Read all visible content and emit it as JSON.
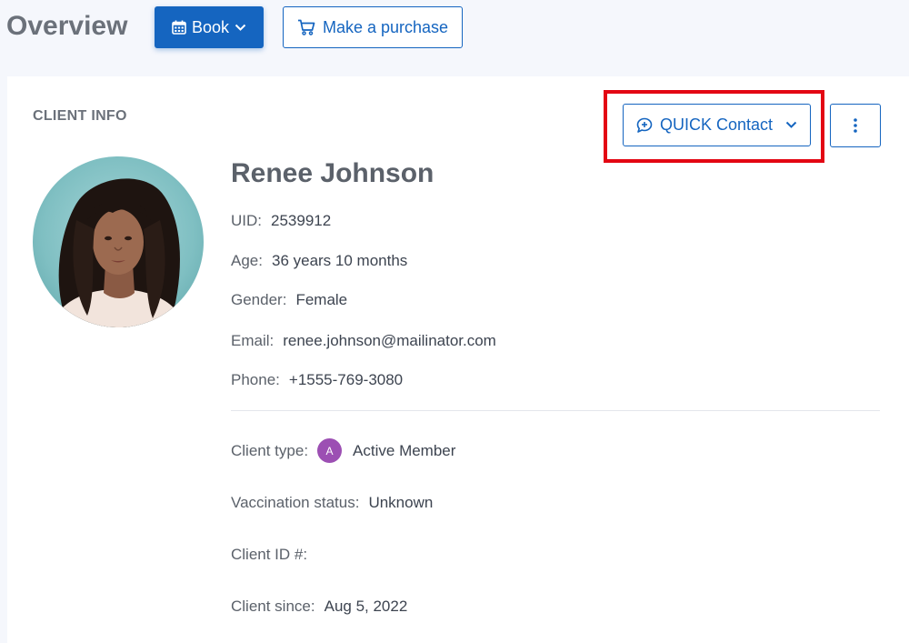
{
  "header": {
    "title": "Overview",
    "book_button": {
      "label": "Book",
      "icon": "calendar-icon",
      "chevron": "chevron-down-icon"
    },
    "purchase_button": {
      "label": "Make a purchase",
      "icon": "cart-icon"
    }
  },
  "client_info": {
    "section_label": "CLIENT INFO",
    "quick_contact": {
      "label": "QUICK Contact",
      "icon": "chat-plus-icon",
      "chevron": "chevron-down-icon",
      "highlight_color": "#e30613"
    },
    "more_menu_icon": "vertical-dots-icon",
    "name": "Renee Johnson",
    "fields": {
      "uid": {
        "label": "UID:",
        "value": "2539912"
      },
      "age": {
        "label": "Age:",
        "value": "36 years 10 months"
      },
      "gender": {
        "label": "Gender:",
        "value": "Female"
      },
      "email": {
        "label": "Email:",
        "value": "renee.johnson@mailinator.com"
      },
      "phone": {
        "label": "Phone:",
        "value": "+1555-769-3080"
      },
      "client_type": {
        "label": "Client type:",
        "badge": "A",
        "value": "Active Member",
        "badge_color": "#9c4fb3"
      },
      "vaccination": {
        "label": "Vaccination status:",
        "value": "Unknown"
      },
      "client_id": {
        "label": "Client ID #:",
        "value": ""
      },
      "client_since": {
        "label": "Client since:",
        "value": "Aug 5, 2022"
      }
    }
  },
  "colors": {
    "accent": "#1565c0",
    "background": "#f5f7fc"
  }
}
